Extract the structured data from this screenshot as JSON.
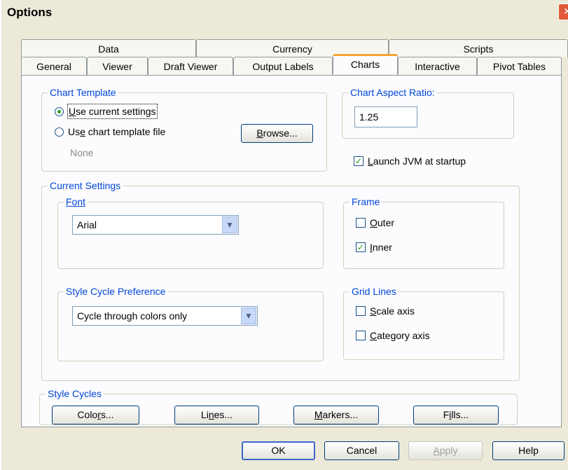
{
  "window": {
    "title": "Options"
  },
  "tabs": {
    "row_top": [
      {
        "label": "Data"
      },
      {
        "label": "Currency"
      },
      {
        "label": "Scripts"
      }
    ],
    "row_bottom": [
      {
        "label": "General"
      },
      {
        "label": "Viewer"
      },
      {
        "label": "Draft Viewer"
      },
      {
        "label": "Output Labels"
      },
      {
        "label": "Charts",
        "active": true
      },
      {
        "label": "Interactive"
      },
      {
        "label": "Pivot Tables"
      }
    ]
  },
  "chart_template": {
    "label": "Chart Template",
    "use_current": {
      "pre": "",
      "accel": "U",
      "post": "se current settings",
      "selected": true
    },
    "use_file": {
      "pre": "Us",
      "accel": "e",
      "post": " chart template file",
      "selected": false
    },
    "browse": {
      "pre": "",
      "accel": "B",
      "post": "rowse..."
    },
    "file_name": "None"
  },
  "aspect_ratio": {
    "label": "Chart Aspect Ratio:",
    "value": "1.25"
  },
  "launch_jvm": {
    "pre": "",
    "accel": "L",
    "post": "aunch JVM at startup",
    "checked": true
  },
  "current_settings": {
    "label": "Current Settings",
    "font": {
      "label": "Font",
      "value": "Arial"
    },
    "frame": {
      "label": "Frame",
      "outer": {
        "pre": "",
        "accel": "O",
        "post": "uter",
        "checked": false
      },
      "inner": {
        "pre": "",
        "accel": "I",
        "post": "nner",
        "checked": true
      }
    },
    "style_cycle": {
      "label": "Style Cycle Preference",
      "value": "Cycle through colors only"
    },
    "grid_lines": {
      "label": "Grid Lines",
      "scale": {
        "pre": "",
        "accel": "S",
        "post": "cale axis",
        "checked": false
      },
      "category": {
        "pre": "",
        "accel": "C",
        "post": "ategory axis",
        "checked": false
      }
    }
  },
  "style_cycles": {
    "label": "Style Cycles",
    "colors": {
      "pre": "Colo",
      "accel": "r",
      "post": "s..."
    },
    "lines": {
      "pre": "Li",
      "accel": "n",
      "post": "es..."
    },
    "markers": {
      "pre": "",
      "accel": "M",
      "post": "arkers..."
    },
    "fills": {
      "pre": "F",
      "accel": "i",
      "post": "lls..."
    }
  },
  "footer": {
    "ok": "OK",
    "cancel": "Cancel",
    "apply": {
      "pre": "",
      "accel": "A",
      "post": "pply"
    },
    "help": "Help"
  },
  "colors": {
    "accent_tab": "#f7a531",
    "group_label": "#0046d5",
    "check": "#21a121"
  },
  "icons": {
    "close": "close-icon",
    "dropdown": "chevron-down-icon",
    "radio": "radio-icon",
    "check": "checkmark-icon"
  }
}
